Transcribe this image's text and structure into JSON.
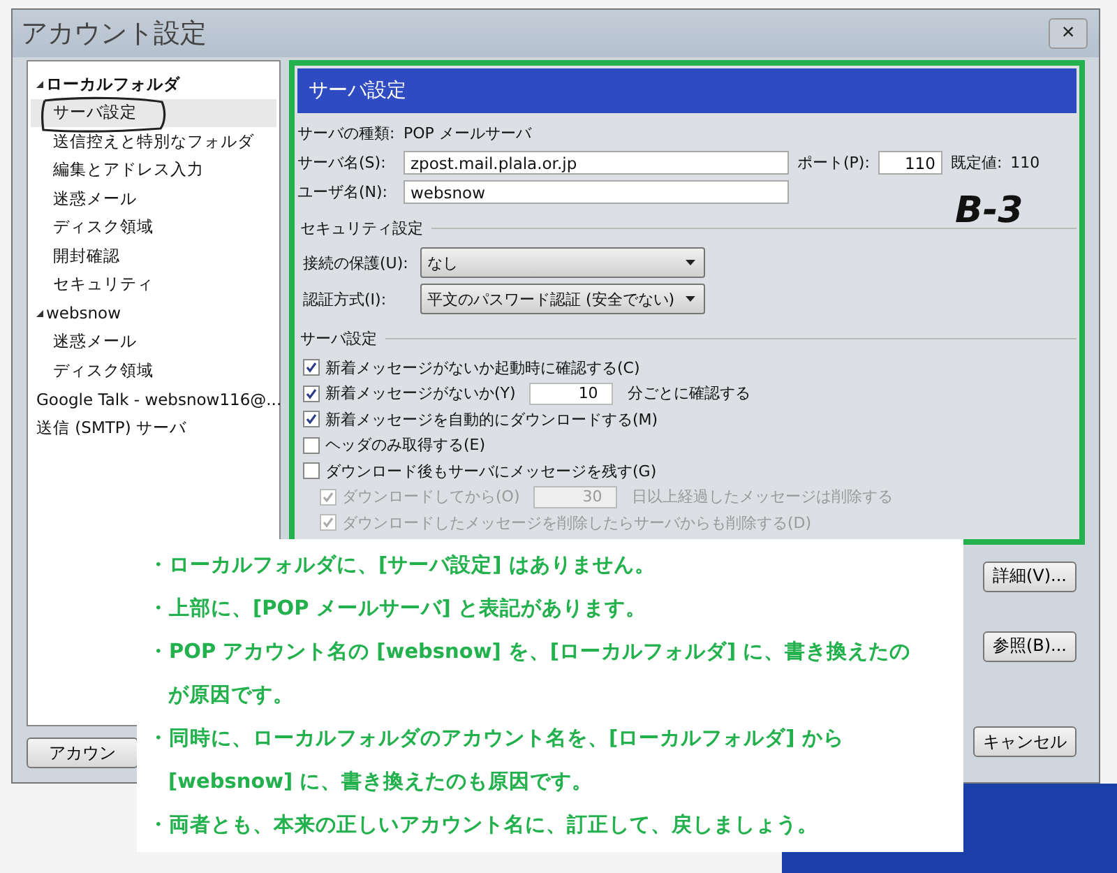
{
  "window": {
    "title": "アカウント設定",
    "close": "×"
  },
  "tree": [
    {
      "label": "ローカルフォルダ",
      "selected": false,
      "expanded": true,
      "children": [
        {
          "label": "サーバ設定",
          "selected": true,
          "circled": true
        },
        {
          "label": "送信控えと特別なフォルダ",
          "selected": false
        },
        {
          "label": "編集とアドレス入力",
          "selected": false
        },
        {
          "label": "迷惑メール",
          "selected": false
        },
        {
          "label": "ディスク領域",
          "selected": false
        },
        {
          "label": "開封確認",
          "selected": false
        },
        {
          "label": "セキュリティ",
          "selected": false
        }
      ]
    },
    {
      "label": "websnow",
      "selected": false,
      "expanded": true,
      "children": [
        {
          "label": "迷惑メール",
          "selected": false
        },
        {
          "label": "ディスク領域",
          "selected": false
        }
      ]
    },
    {
      "label": "Google Talk - websnow116@...",
      "selected": false
    },
    {
      "label": "送信 (SMTP) サーバ",
      "selected": false
    }
  ],
  "account_button": "アカウン",
  "panel": {
    "title": "サーバ設定",
    "server_type_label": "サーバの種類:",
    "server_type": "POP メールサーバ",
    "fields": [
      {
        "label": "サーバ名(S):",
        "value": "zpost.mail.plala.or.jp"
      },
      {
        "label": "ユーザ名(N):",
        "value": "websnow"
      }
    ],
    "port": {
      "label": "ポート(P):",
      "value": "110",
      "default_label": "既定値:",
      "default_value": "110"
    },
    "security": {
      "heading": "セキュリティ設定",
      "rows": [
        {
          "label": "接続の保護(U):",
          "value": "なし"
        },
        {
          "label": "認証方式(I):",
          "value": "平文のパスワード認証 (安全でない)"
        }
      ]
    },
    "server": {
      "heading": "サーバ設定",
      "options": [
        {
          "kind": "check",
          "label": "新着メッセージがないか起動時に確認する(C)",
          "checked": true,
          "disabled": false
        },
        {
          "kind": "spin",
          "label": "新着メッセージがないか(Y)",
          "value": "10",
          "suffix": "分ごとに確認する",
          "checked": true,
          "disabled": false
        },
        {
          "kind": "check",
          "label": "新着メッセージを自動的にダウンロードする(M)",
          "checked": true,
          "disabled": false
        },
        {
          "kind": "check",
          "label": "ヘッダのみ取得する(E)",
          "checked": false,
          "disabled": false
        },
        {
          "kind": "check",
          "label": "ダウンロード後もサーバにメッセージを残す(G)",
          "checked": false,
          "disabled": false,
          "children": [
            {
              "kind": "spin",
              "label": "ダウンロードしてから(O)",
              "value": "30",
              "suffix": "日以上経過したメッセージは削除する",
              "checked": true,
              "disabled": true
            },
            {
              "kind": "check",
              "label": "ダウンロードしたメッセージを削除したらサーバからも削除する(D)",
              "checked": true,
              "disabled": true
            }
          ]
        }
      ]
    }
  },
  "buttons": [
    {
      "label": "詳細(V)..."
    },
    {
      "label": "参照(B)..."
    }
  ],
  "cancel_button": "キャンセル",
  "annotation": {
    "handwritten": "B-3",
    "notes": [
      "・ローカルフォルダに、[サーバ設定] はありません。",
      "・上部に、[POP メールサーバ] と表記があります。",
      "・POP アカウント名の [websnow] を、[ローカルフォルダ] に、書き換えたのが原因です。",
      "・同時に、ローカルフォルダのアカウント名を、[ローカルフォルダ] から [websnow] に、書き換えたのも原因です。",
      "・両者とも、本来の正しいアカウント名に、訂正して、戻しましょう。"
    ]
  }
}
